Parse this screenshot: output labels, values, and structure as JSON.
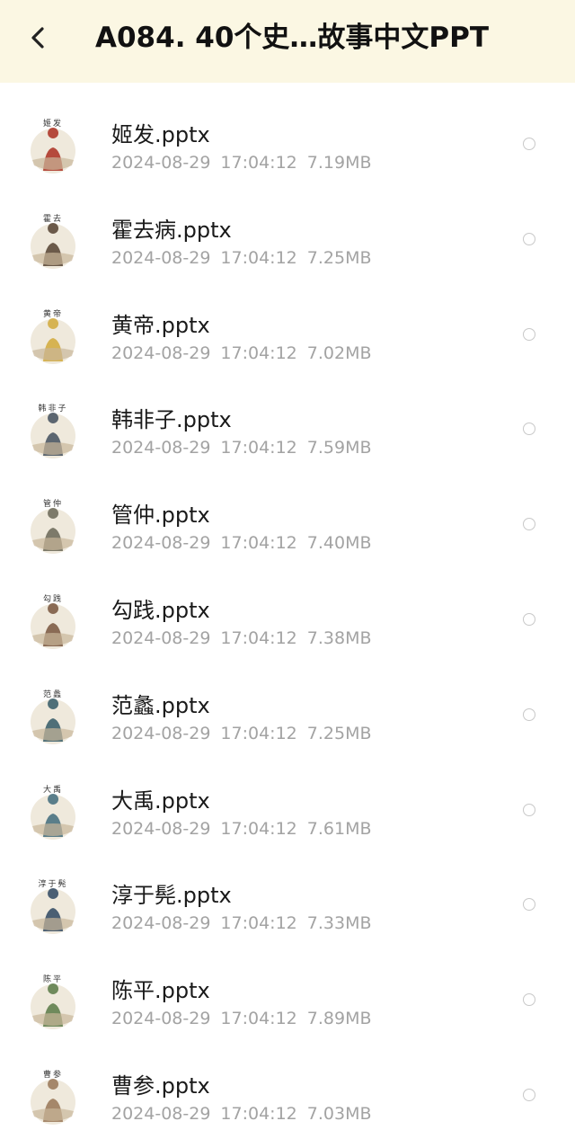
{
  "header": {
    "title": "A084. 40个史…故事中文PPT",
    "back_icon": "chevron-left-icon",
    "background": "#fbf7e3"
  },
  "files": [
    {
      "name": "姬发.pptx",
      "caption": "姬发",
      "date": "2024-08-29",
      "time": "17:04:12",
      "size": "7.19MB",
      "thumb_color": "#b54a3c"
    },
    {
      "name": "霍去病.pptx",
      "caption": "霍去",
      "date": "2024-08-29",
      "time": "17:04:12",
      "size": "7.25MB",
      "thumb_color": "#6b5a4a"
    },
    {
      "name": "黄帝.pptx",
      "caption": "黄帝",
      "date": "2024-08-29",
      "time": "17:04:12",
      "size": "7.02MB",
      "thumb_color": "#d6b352"
    },
    {
      "name": "韩非子.pptx",
      "caption": "韩非子",
      "date": "2024-08-29",
      "time": "17:04:12",
      "size": "7.59MB",
      "thumb_color": "#5c6670"
    },
    {
      "name": "管仲.pptx",
      "caption": "管仲",
      "date": "2024-08-29",
      "time": "17:04:12",
      "size": "7.40MB",
      "thumb_color": "#7d7a6a"
    },
    {
      "name": "勾践.pptx",
      "caption": "勾践",
      "date": "2024-08-29",
      "time": "17:04:12",
      "size": "7.38MB",
      "thumb_color": "#8a6b55"
    },
    {
      "name": "范蠡.pptx",
      "caption": "范蠡",
      "date": "2024-08-29",
      "time": "17:04:12",
      "size": "7.25MB",
      "thumb_color": "#4f6f78"
    },
    {
      "name": "大禹.pptx",
      "caption": "大禹",
      "date": "2024-08-29",
      "time": "17:04:12",
      "size": "7.61MB",
      "thumb_color": "#5a7e8a"
    },
    {
      "name": "淳于髡.pptx",
      "caption": "淳于髡",
      "date": "2024-08-29",
      "time": "17:04:12",
      "size": "7.33MB",
      "thumb_color": "#4b5f73"
    },
    {
      "name": "陈平.pptx",
      "caption": "陈平",
      "date": "2024-08-29",
      "time": "17:04:12",
      "size": "7.89MB",
      "thumb_color": "#6f8a5c"
    },
    {
      "name": "曹参.pptx",
      "caption": "曹参",
      "date": "2024-08-29",
      "time": "17:04:12",
      "size": "7.03MB",
      "thumb_color": "#a5876a"
    }
  ]
}
